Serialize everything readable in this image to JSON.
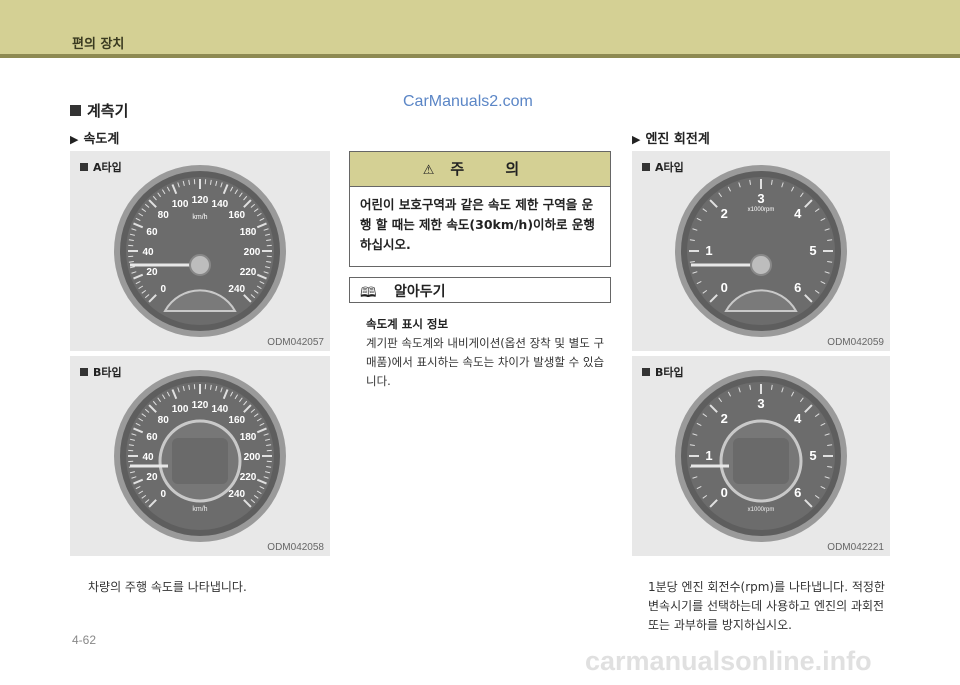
{
  "header": {
    "title": "편의 장치"
  },
  "watermark": "CarManuals2.com",
  "section_title": "계측기",
  "speedometer": {
    "title": "속도계",
    "panels": [
      {
        "label": "A타입",
        "code": "ODM042057",
        "unit": "km/h",
        "ticks": [
          "0",
          "20",
          "40",
          "60",
          "80",
          "100",
          "120",
          "140",
          "160",
          "180",
          "200",
          "220",
          "240"
        ]
      },
      {
        "label": "B타입",
        "code": "ODM042058",
        "unit": "km/h",
        "ticks": [
          "0",
          "20",
          "40",
          "60",
          "80",
          "100",
          "120",
          "140",
          "160",
          "180",
          "200",
          "220",
          "240"
        ]
      }
    ],
    "caption": "차량의 주행 속도를 나타냅니다."
  },
  "caution": {
    "title": "주 의",
    "body": "어린이 보호구역과 같은 속도 제한 구역을 운행 할 때는 제한 속도(30km/h)이하로 운행하십시오."
  },
  "note": {
    "title": "알아두기",
    "subtitle": "속도계 표시 정보",
    "body": "계기판 속도계와 내비게이션(옵션 장착 및 별도 구매품)에서 표시하는 속도는 차이가 발생할 수 있습니다."
  },
  "tachometer": {
    "title": "엔진 회전계",
    "panels": [
      {
        "label": "A타입",
        "code": "ODM042059",
        "unit": "x1000rpm",
        "ticks": [
          "0",
          "1",
          "2",
          "3",
          "4",
          "5",
          "6"
        ]
      },
      {
        "label": "B타입",
        "code": "ODM042221",
        "unit": "x1000rpm",
        "ticks": [
          "0",
          "1",
          "2",
          "3",
          "4",
          "5",
          "6"
        ]
      }
    ],
    "caption": "1분당 엔진 회전수(rpm)를 나타냅니다. 적정한 변속시기를 선택하는데 사용하고 엔진의 과회전 또는 과부하를 방지하십시오."
  },
  "page_number": "4-62",
  "footer_watermark": "carmanualsonline.info"
}
